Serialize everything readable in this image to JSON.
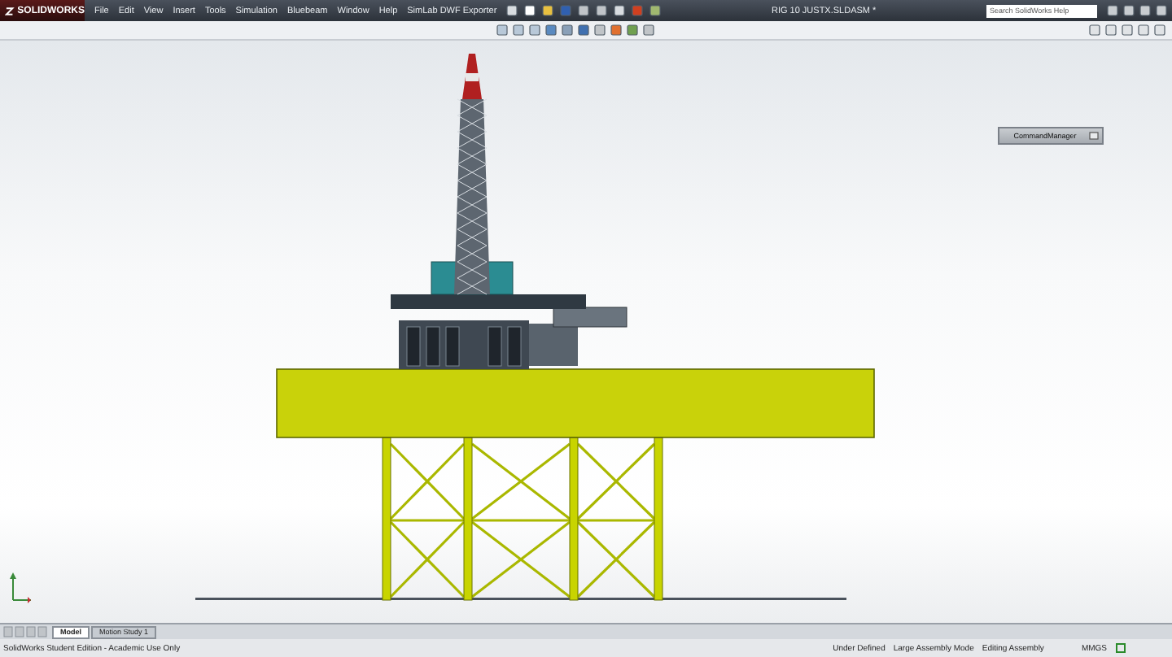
{
  "app": {
    "logo": "SOLIDWORKS"
  },
  "menu": [
    "File",
    "Edit",
    "View",
    "Insert",
    "Tools",
    "Simulation",
    "Bluebeam",
    "Window",
    "Help",
    "SimLab DWF Exporter"
  ],
  "window": {
    "title": "RIG 10 JUSTX.SLDASM *"
  },
  "search": {
    "placeholder": "Search SolidWorks Help"
  },
  "command_manager": {
    "label": "CommandManager"
  },
  "tabs": [
    {
      "label": "Model",
      "selected": true
    },
    {
      "label": "Motion Study 1",
      "selected": false
    }
  ],
  "status_bar": {
    "edition": "SolidWorks Student Edition - Academic Use Only",
    "items": [
      "Under Defined",
      "Large Assembly Mode",
      "Editing Assembly",
      "MMGS"
    ]
  }
}
